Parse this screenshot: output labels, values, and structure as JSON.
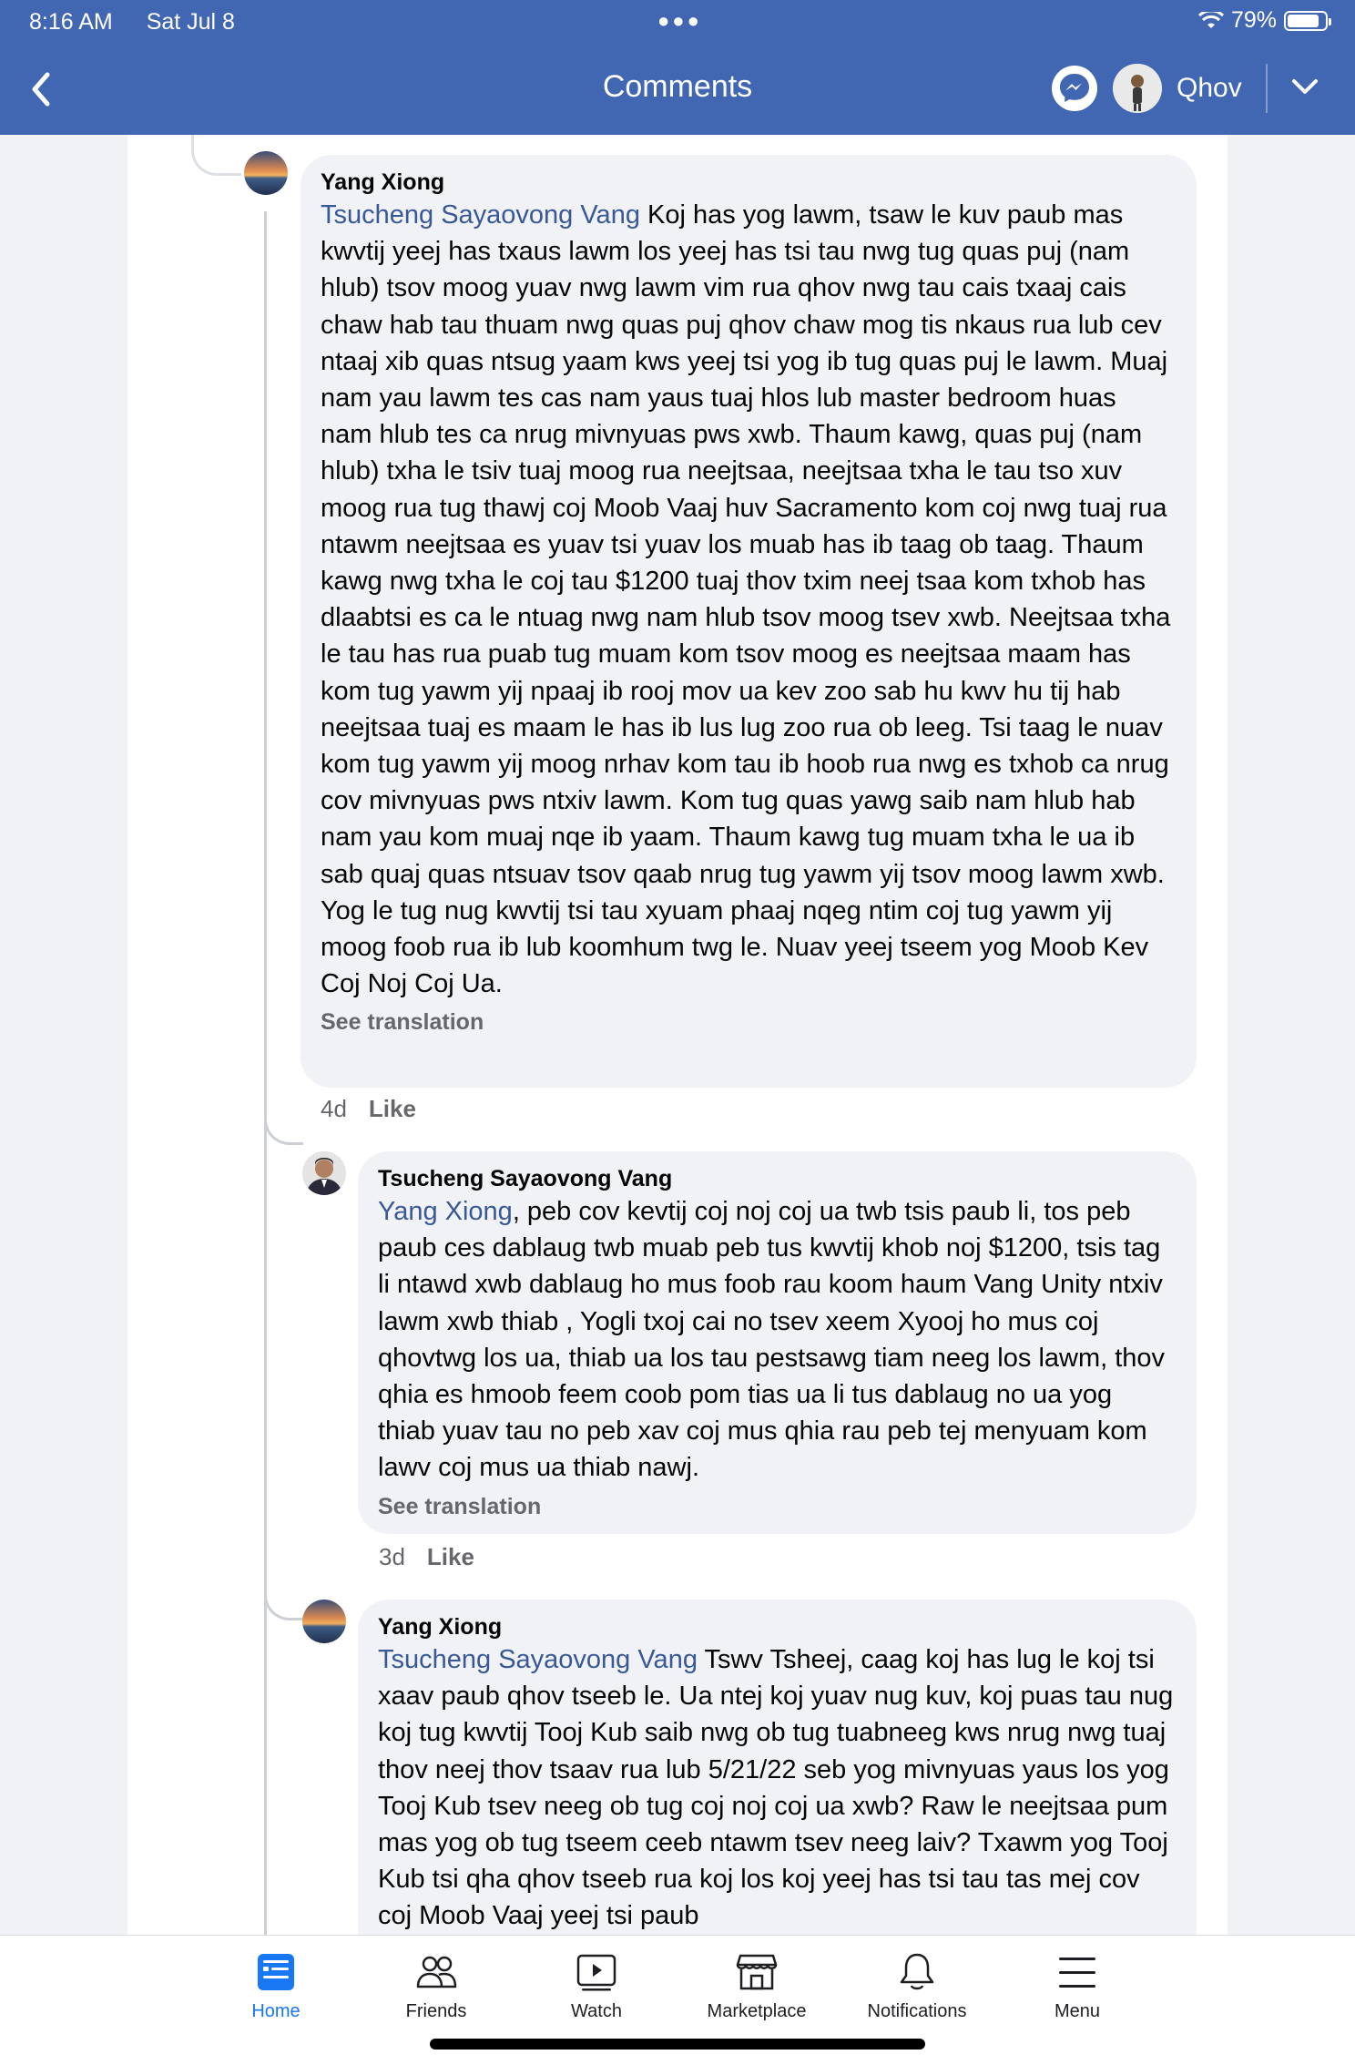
{
  "status_bar": {
    "time": "8:16 AM",
    "date": "Sat Jul 8",
    "battery": "79%"
  },
  "header": {
    "title": "Comments",
    "account_name": "Qhov"
  },
  "comments": [
    {
      "author": "Yang Xiong",
      "mention": "Tsucheng Sayaovong Vang",
      "text": " Koj has yog lawm, tsaw le kuv paub mas kwvtij yeej has txaus lawm los yeej has tsi tau nwg tug quas puj (nam hlub) tsov moog yuav nwg lawm vim rua qhov nwg tau cais txaaj cais chaw hab tau thuam nwg quas puj qhov chaw mog tis nkaus rua lub cev ntaaj xib quas ntsug yaam kws yeej tsi yog ib tug quas puj le lawm. Muaj nam yau lawm tes cas nam yaus tuaj hlos lub master bedroom huas nam hlub tes ca nrug mivnyuas pws xwb. Thaum kawg, quas puj (nam hlub) txha le tsiv tuaj moog rua neejtsaa, neejtsaa txha le tau tso xuv moog rua tug thawj coj Moob Vaaj huv Sacramento kom coj nwg tuaj rua ntawm neejtsaa es yuav tsi yuav los muab has ib taag ob taag.  Thaum kawg nwg txha le coj tau $1200 tuaj thov txim neej tsaa kom txhob has dlaabtsi es ca le ntuag nwg nam hlub tsov moog tsev xwb. Neejtsaa txha le tau has rua puab tug muam kom tsov moog es neejtsaa maam has kom tug yawm yij npaaj ib rooj mov ua kev zoo sab hu kwv hu tij hab neejtsaa tuaj es maam le has ib lus lug zoo rua ob leeg.  Tsi taag le nuav kom tug yawm yij moog nrhav kom tau ib hoob rua nwg es txhob ca nrug cov mivnyuas pws ntxiv lawm. Kom tug quas yawg saib nam hlub hab nam yau kom muaj nqe ib yaam. Thaum kawg tug muam txha le ua ib sab quaj quas ntsuav tsov qaab nrug tug yawm yij tsov moog lawm xwb. Yog le tug nug kwvtij tsi tau xyuam phaaj nqeg ntim coj tug yawm yij moog foob rua ib lub koomhum twg le. Nuav yeej tseem yog Moob Kev Coj Noj Coj Ua.",
      "see_translation": "See translation",
      "age": "4d",
      "like": "Like"
    },
    {
      "author": "Tsucheng Sayaovong Vang",
      "mention": "Yang Xiong",
      "text": ", peb cov kevtij coj noj coj ua twb tsis paub li, tos peb paub ces dablaug twb muab peb tus kwvtij khob noj $1200, tsis tag li ntawd xwb dablaug ho mus foob rau koom haum Vang Unity ntxiv lawm xwb thiab , Yogli txoj cai no tsev xeem Xyooj ho mus coj qhovtwg  los ua, thiab ua los tau pestsawg tiam neeg los lawm, thov qhia es hmoob feem coob pom tias ua li tus dablaug no ua yog thiab yuav tau no peb xav coj mus qhia rau peb tej menyuam kom lawv coj mus ua thiab nawj.",
      "see_translation": "See translation",
      "age": "3d",
      "like": "Like"
    },
    {
      "author": "Yang Xiong",
      "mention": "Tsucheng Sayaovong Vang",
      "text": " Tswv Tsheej, caag koj has lug le koj tsi xaav paub qhov tseeb le. Ua ntej koj yuav nug kuv, koj puas tau nug koj tug kwvtij Tooj Kub saib nwg ob tug tuabneeg kws nrug nwg tuaj thov neej thov tsaav rua lub 5/21/22 seb yog mivnyuas yaus los yog Tooj Kub tsev neeg ob tug coj noj coj ua xwb? Raw le neejtsaa pum mas yog ob tug tseem ceeb ntawm tsev neeg laiv?  Txawm yog Tooj Kub tsi qha qhov tseeb rua koj los koj yeej has tsi tau tas mej cov coj Moob Vaaj yeej tsi paub"
    }
  ],
  "nav": [
    {
      "label": "Home",
      "icon": "home-icon",
      "active": true
    },
    {
      "label": "Friends",
      "icon": "friends-icon"
    },
    {
      "label": "Watch",
      "icon": "watch-icon"
    },
    {
      "label": "Marketplace",
      "icon": "marketplace-icon"
    },
    {
      "label": "Notifications",
      "icon": "notifications-icon"
    },
    {
      "label": "Menu",
      "icon": "menu-icon"
    }
  ],
  "colors": {
    "header": "#4267b2",
    "mention": "#385898",
    "bubble": "#f0f2f5",
    "active_nav": "#1877f2"
  }
}
